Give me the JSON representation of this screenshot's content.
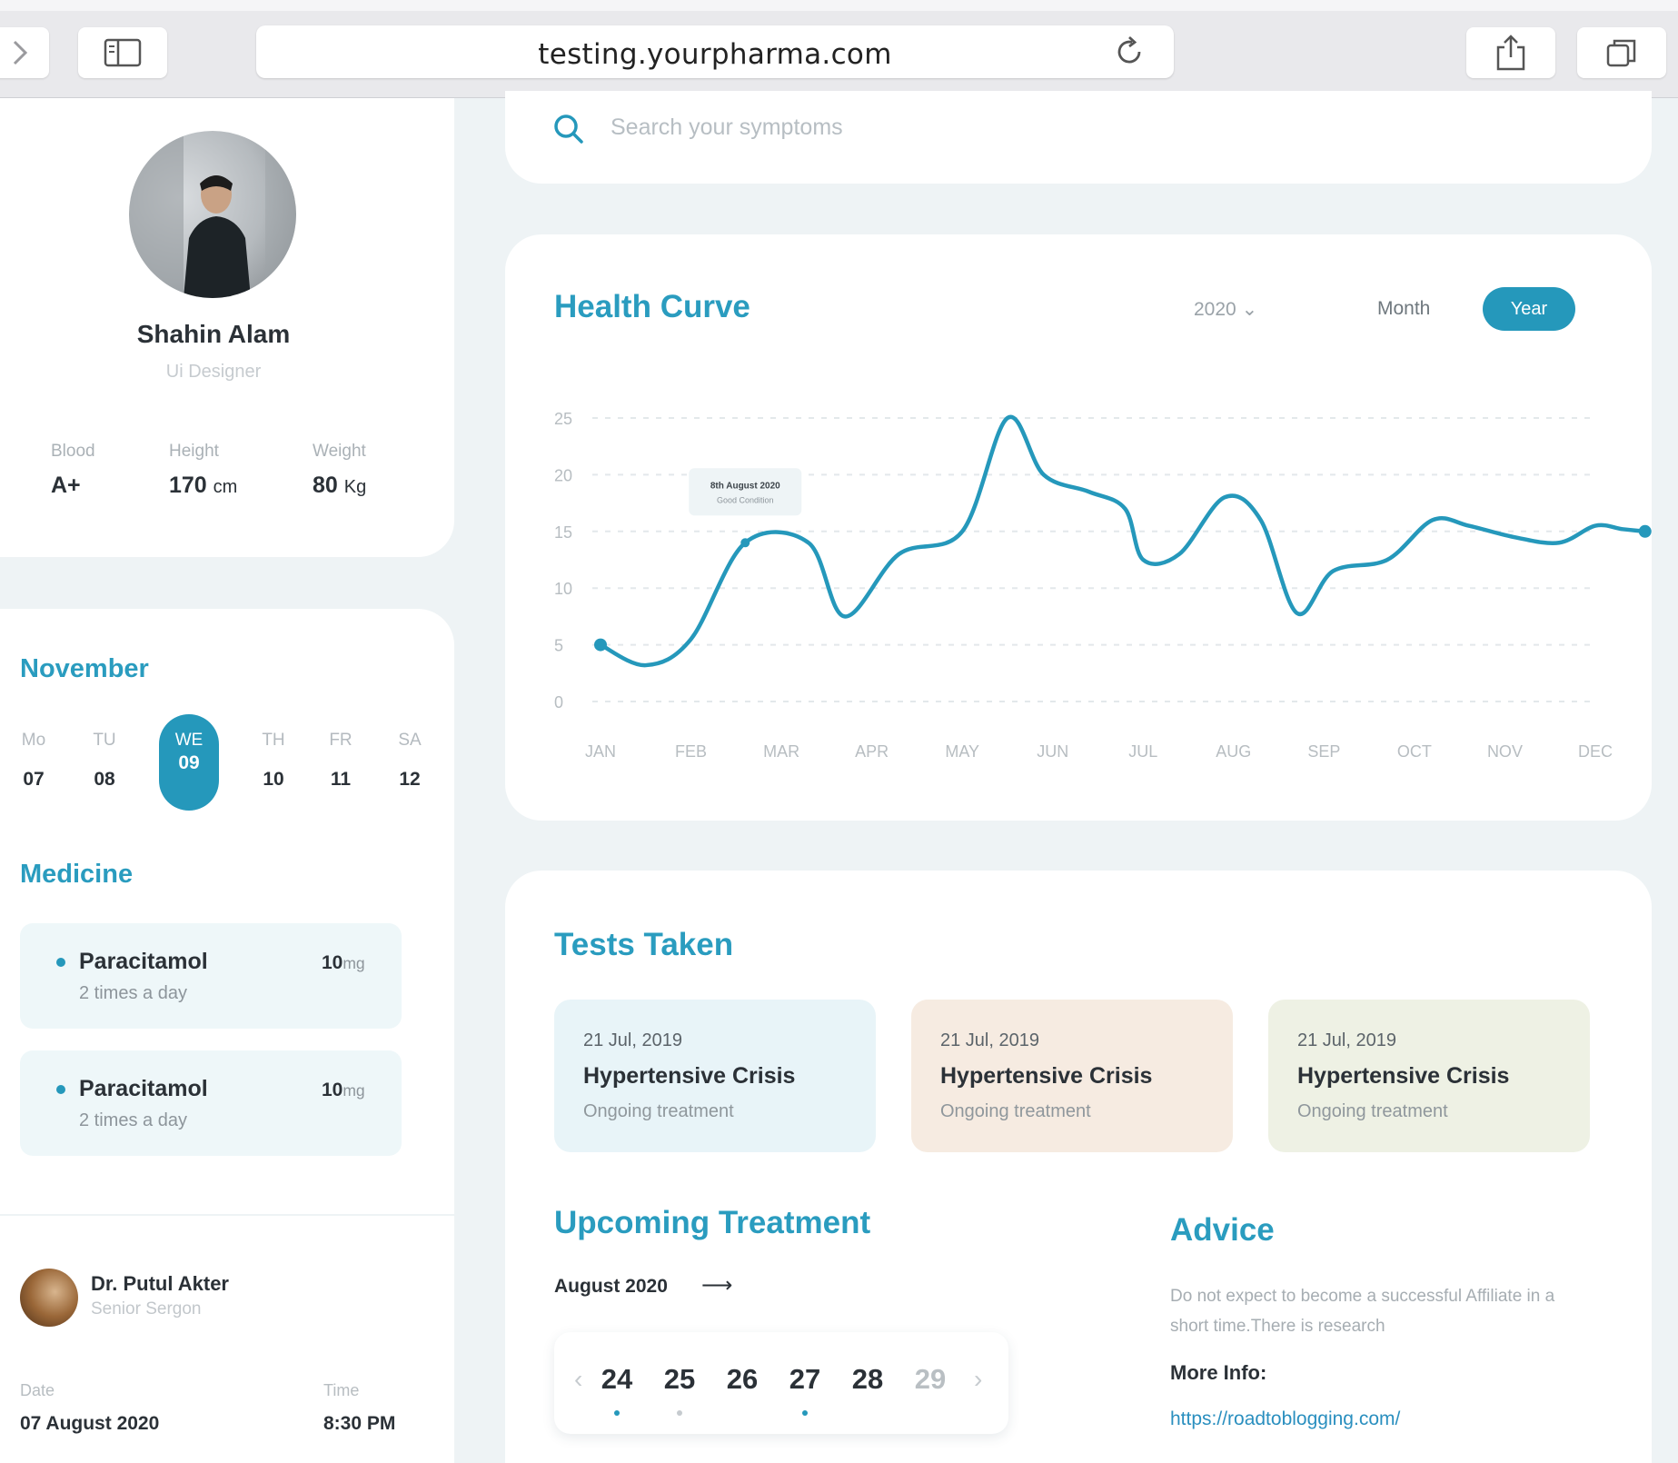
{
  "browser": {
    "url": "testing.yourpharma.com"
  },
  "profile": {
    "name": "Shahin Alam",
    "role": "Ui Designer",
    "stats": [
      {
        "label": "Blood",
        "value": "A+",
        "unit": ""
      },
      {
        "label": "Height",
        "value": "170",
        "unit": "cm"
      },
      {
        "label": "Weight",
        "value": "80",
        "unit": "Kg"
      }
    ]
  },
  "calendar": {
    "month": "November",
    "days": [
      {
        "name": "Mo",
        "date": "07"
      },
      {
        "name": "TU",
        "date": "08"
      },
      {
        "name": "WE",
        "date": "09",
        "active": true
      },
      {
        "name": "TH",
        "date": "10"
      },
      {
        "name": "FR",
        "date": "11"
      },
      {
        "name": "SA",
        "date": "12"
      }
    ]
  },
  "medicine": {
    "title": "Medicine",
    "items": [
      {
        "name": "Paracitamol",
        "frequency": "2 times a day",
        "dose": "10",
        "unit": "mg"
      },
      {
        "name": "Paracitamol",
        "frequency": "2 times a day",
        "dose": "10",
        "unit": "mg"
      }
    ]
  },
  "doctor": {
    "name": "Dr. Putul Akter",
    "role": "Senior Sergon",
    "date_label": "Date",
    "date": "07 August 2020",
    "time_label": "Time",
    "time": "8:30 PM"
  },
  "search": {
    "placeholder": "Search your symptoms"
  },
  "health_curve": {
    "title": "Health Curve",
    "year": "2020",
    "tab_month": "Month",
    "tab_year": "Year",
    "accent": "#2598bb"
  },
  "chart_data": {
    "type": "line",
    "title": "Health Curve",
    "categories": [
      "JAN",
      "FEB",
      "MAR",
      "APR",
      "MAY",
      "JUN",
      "JUL",
      "AUG",
      "SEP",
      "OCT",
      "NOV",
      "DEC"
    ],
    "yticks": [
      0,
      5,
      10,
      15,
      20,
      25
    ],
    "ylim": [
      0,
      25
    ],
    "grid": true,
    "series": [
      {
        "x": [
          0,
          0.5,
          1.0,
          1.6,
          2.3,
          2.7,
          3.3,
          4.0,
          4.5,
          4.9,
          5.4,
          5.8,
          6.0,
          6.4,
          6.9,
          7.3,
          7.7,
          8.1,
          8.7,
          9.2,
          9.6,
          10.1,
          10.6,
          11.0,
          11.3,
          11.55
        ],
        "y": [
          5,
          3.2,
          5.5,
          14,
          14,
          7.5,
          13,
          15,
          25,
          20,
          18.5,
          17,
          12.5,
          13,
          18,
          16,
          7.8,
          11.5,
          12.5,
          16,
          15.5,
          14.5,
          14,
          15.5,
          15.2,
          15
        ]
      }
    ],
    "tooltip": {
      "title": "8th August 2020",
      "subtitle": "Good Condition"
    }
  },
  "tests": {
    "title": "Tests Taken",
    "items": [
      {
        "date": "21 Jul, 2019",
        "name": "Hypertensive Crisis",
        "status": "Ongoing treatment",
        "color": "#e8f4f8"
      },
      {
        "date": "21 Jul, 2019",
        "name": "Hypertensive Crisis",
        "status": "Ongoing treatment",
        "color": "#f6ebe1"
      },
      {
        "date": "21 Jul, 2019",
        "name": "Hypertensive Crisis",
        "status": "Ongoing treatment",
        "color": "#eef1e4"
      }
    ]
  },
  "upcoming": {
    "title": "Upcoming Treatment",
    "month": "August 2020",
    "arrow": "⟶",
    "dates": [
      {
        "n": "24",
        "dot": "#2598bb",
        "muted": false
      },
      {
        "n": "25",
        "dot": "#c6cbcf",
        "muted": false
      },
      {
        "n": "26",
        "dot": "",
        "muted": false
      },
      {
        "n": "27",
        "dot": "#2598bb",
        "muted": false
      },
      {
        "n": "28",
        "dot": "",
        "muted": false
      },
      {
        "n": "29",
        "dot": "",
        "muted": true
      }
    ],
    "prev": "‹",
    "next": "›"
  },
  "advice": {
    "title": "Advice",
    "text": "Do not expect to become a successful Affiliate in a short time.There is research",
    "more_label": "More Info:",
    "link": "https://roadtoblogging.com/"
  }
}
